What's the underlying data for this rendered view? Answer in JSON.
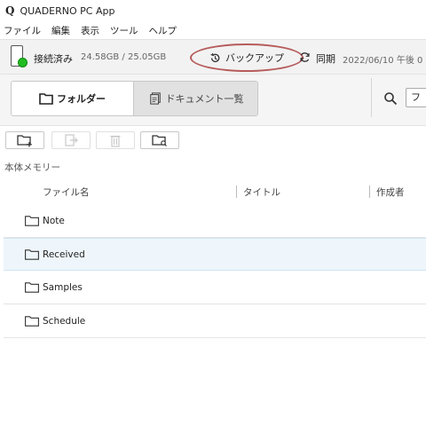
{
  "app": {
    "logo": "Q",
    "title": "QUADERNO PC App"
  },
  "menu": [
    "ファイル",
    "編集",
    "表示",
    "ツール",
    "ヘルプ"
  ],
  "status": {
    "connection": "接続済み",
    "storage": "24.58GB / 25.05GB",
    "backup_label": "バックアップ",
    "sync_label": "同期",
    "sync_time": "2022/06/10 午後 0"
  },
  "view_tabs": {
    "folder": "フォルダー",
    "documents": "ドキュメント一覧"
  },
  "search": {
    "value": "フ"
  },
  "section": "本体メモリー",
  "columns": {
    "name": "ファイル名",
    "title": "タイトル",
    "author": "作成者"
  },
  "folders": [
    {
      "name": "Note"
    },
    {
      "name": "Received"
    },
    {
      "name": "Samples"
    },
    {
      "name": "Schedule"
    }
  ],
  "colors": {
    "connected": "#22bb22",
    "highlight_circle": "#b75b5b",
    "selected_row": "#eef6fb"
  },
  "selected_folder": "Received"
}
